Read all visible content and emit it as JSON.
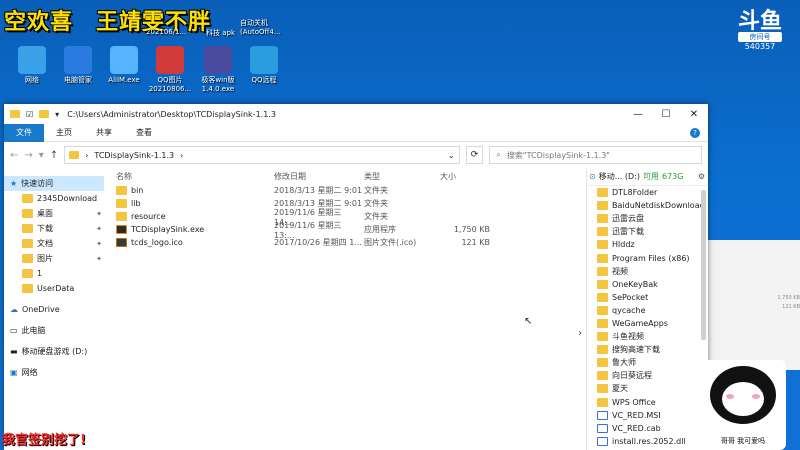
{
  "desktop": {
    "banner1": "空欢喜",
    "banner2": "王靖雯不胖",
    "top_labels": [
      "202106/1...",
      "apk",
      "自动关机(AutoOff4..."
    ],
    "top_label_prefixes": [
      "科技"
    ],
    "icons": [
      {
        "label": "网络"
      },
      {
        "label": "电脑管家"
      },
      {
        "label": "AliIM.exe"
      },
      {
        "label": "QQ图片20210806..."
      },
      {
        "label": "极客win版1.4.0.exe"
      },
      {
        "label": "QQ远程"
      }
    ],
    "icon_colors": [
      "#3aa0e8",
      "#2a7be0",
      "#56b4ff",
      "#d23a3a",
      "#4a4a9e",
      "#2a9de0"
    ]
  },
  "douyu": {
    "logo": "斗鱼",
    "room_label": "房间号",
    "room_id": "540357"
  },
  "window": {
    "path": "C:\\Users\\Administrator\\Desktop\\TCDisplaySink-1.1.3",
    "controls": [
      "—",
      "☐",
      "✕"
    ],
    "ribbon_tabs": [
      "文件",
      "主页",
      "共享",
      "查看"
    ],
    "address": {
      "crumb": "TCDisplaySink-1.1.3",
      "search_placeholder": "搜索\"TCDisplaySink-1.1.3\""
    },
    "columns": [
      "名称",
      "修改日期",
      "类型",
      "大小"
    ],
    "files": [
      {
        "name": "bin",
        "date": "2018/3/13 星期二 9:01",
        "type": "文件夹",
        "size": "",
        "kind": "folder"
      },
      {
        "name": "lib",
        "date": "2018/3/13 星期二 9:01",
        "type": "文件夹",
        "size": "",
        "kind": "folder"
      },
      {
        "name": "resource",
        "date": "2019/11/6 星期三 14:...",
        "type": "文件夹",
        "size": "",
        "kind": "folder"
      },
      {
        "name": "TCDisplaySink.exe",
        "date": "2019/11/6 星期三 13:...",
        "type": "应用程序",
        "size": "1,750 KB",
        "kind": "exe"
      },
      {
        "name": "tcds_logo.ico",
        "date": "2017/10/26 星期四 1...",
        "type": "图片文件(.ico)",
        "size": "121 KB",
        "kind": "ico"
      }
    ],
    "nav": {
      "quick_access": "快速访问",
      "quick_items": [
        "2345Download",
        "桌面",
        "下载",
        "文档",
        "图片",
        "1",
        "UserData"
      ],
      "onedrive": "OneDrive",
      "this_pc": "此电脑",
      "drive": "移动硬盘游戏 (D:)",
      "network": "网络"
    },
    "drive_pane": {
      "title": "移动... (D:)",
      "free_label": "可用",
      "free_value": "673G",
      "items": [
        "DTL8Folder",
        "BaiduNetdiskDownload",
        "迅雷云盘",
        "迅雷下载",
        "Hlddz",
        "Program Files (x86)",
        "视频",
        "OneKeyBak",
        "SePocket",
        "qycache",
        "WeGameApps",
        "斗鱼视频",
        "搜狗高速下载",
        "鲁大师",
        "向日葵远程",
        "夏天",
        "WPS Office",
        "VC_RED.MSI",
        "VC_RED.cab",
        "install.res.2052.dll"
      ]
    }
  },
  "bg_window_rows": [
    "",
    "",
    "",
    "",
    "",
    "",
    "1,750 KB",
    "121 KB"
  ],
  "meme_caption": "哥哥  我可爱吗",
  "overlay_text": "我官签别挖了!"
}
